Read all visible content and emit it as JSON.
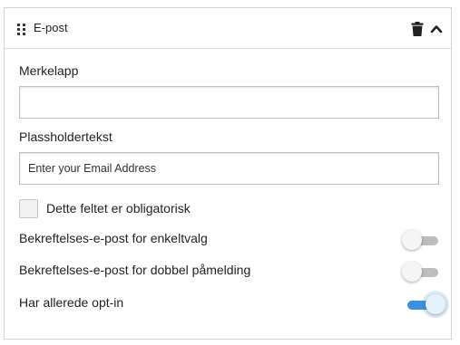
{
  "header": {
    "title": "E-post",
    "drag_icon": "drag-handle-icon",
    "delete_icon": "trash-icon",
    "collapse_icon": "chevron-up-icon"
  },
  "fields": {
    "label_field": {
      "label": "Merkelapp",
      "value": "",
      "placeholder": ""
    },
    "placeholder_field": {
      "label": "Plassholdertekst",
      "value": "Enter your Email Address",
      "placeholder": ""
    }
  },
  "required_checkbox": {
    "label": "Dette feltet er obligatorisk",
    "checked": false
  },
  "toggles": [
    {
      "label": "Bekreftelses-e-post for enkeltvalg",
      "on": false
    },
    {
      "label": "Bekreftelses-e-post for dobbel påmelding",
      "on": false
    },
    {
      "label": "Har allerede opt-in",
      "on": true
    }
  ],
  "colors": {
    "toggle_on": "#3d8fde",
    "toggle_off": "#bdbdbd",
    "border": "#d3d3d3"
  }
}
